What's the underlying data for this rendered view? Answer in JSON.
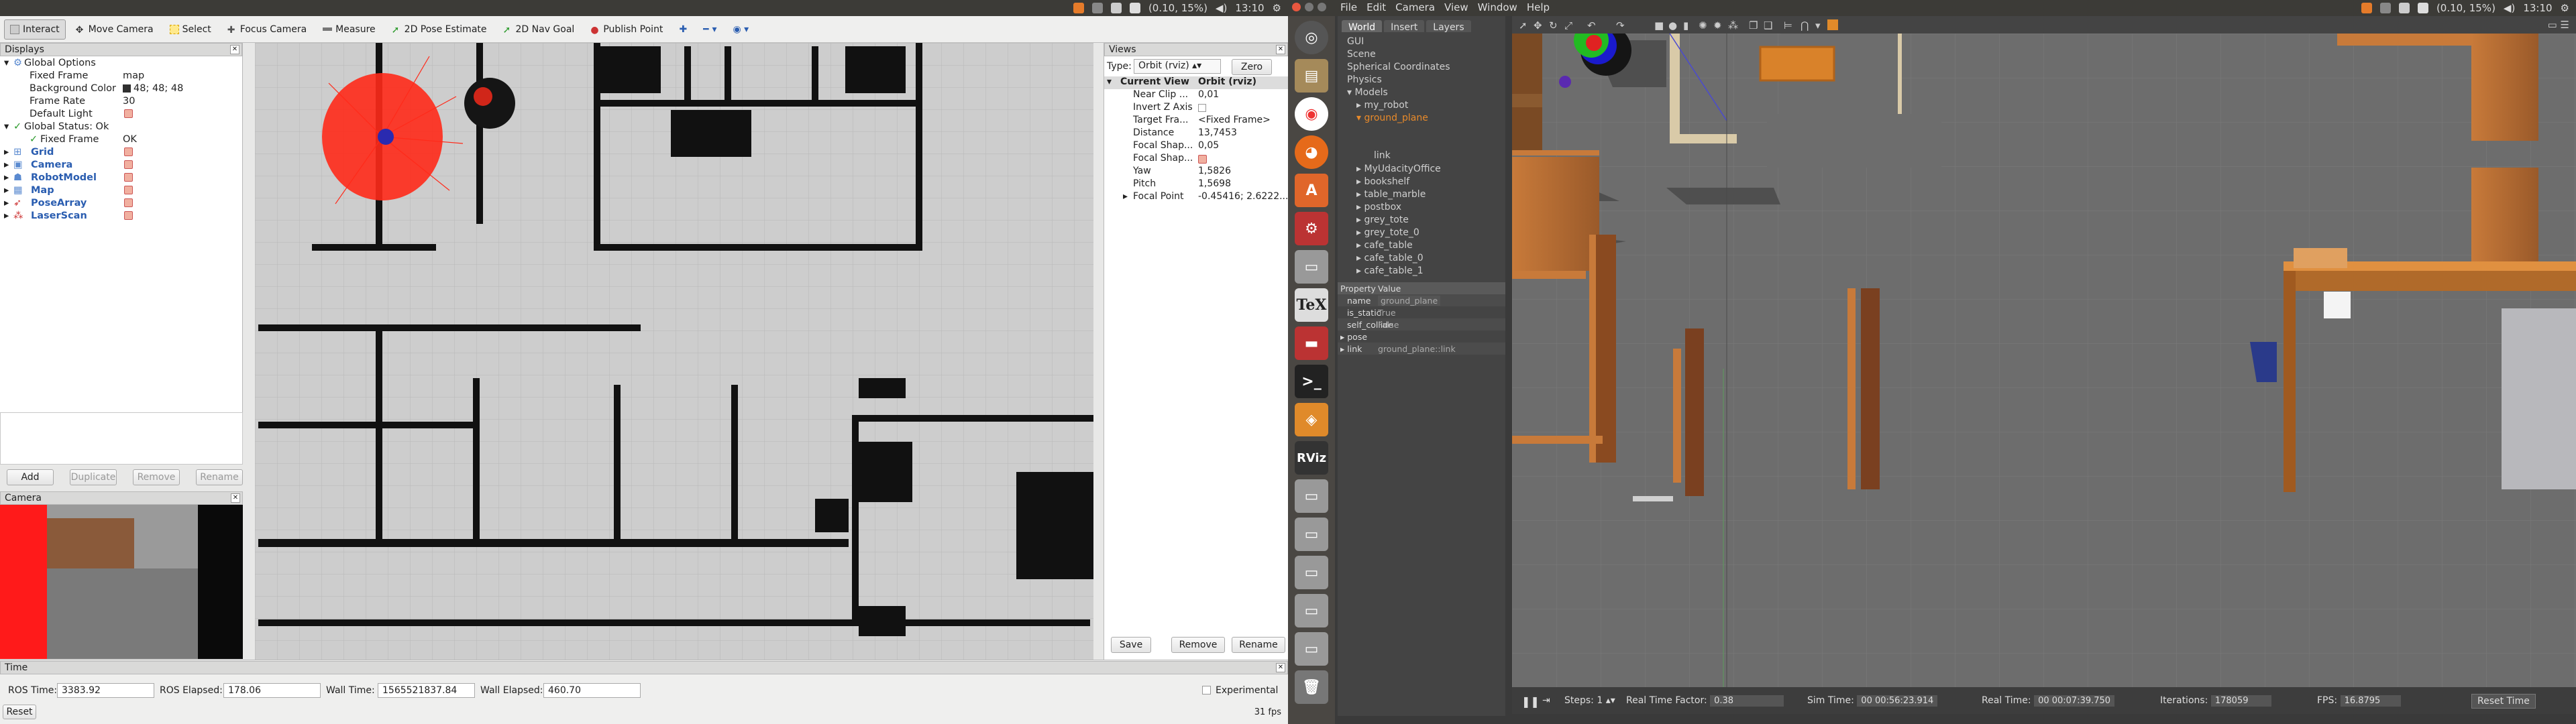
{
  "left_panel": {
    "time": "13:10",
    "coords": "(0.10, 15%)"
  },
  "rviz": {
    "tools": [
      {
        "label": "Interact",
        "icon": "interact-icon"
      },
      {
        "label": "Move Camera",
        "icon": "move-camera-icon"
      },
      {
        "label": "Select",
        "icon": "select-icon"
      },
      {
        "label": "Focus Camera",
        "icon": "focus-camera-icon"
      },
      {
        "label": "Measure",
        "icon": "measure-icon"
      },
      {
        "label": "2D Pose Estimate",
        "icon": "pose-estimate-icon"
      },
      {
        "label": "2D Nav Goal",
        "icon": "nav-goal-icon"
      },
      {
        "label": "Publish Point",
        "icon": "publish-point-icon"
      }
    ],
    "displays": {
      "title": "Displays",
      "global_options": "Global Options",
      "fixed_frame_k": "Fixed Frame",
      "fixed_frame_v": "map",
      "bg_k": "Background Color",
      "bg_v": "48; 48; 48",
      "rate_k": "Frame Rate",
      "rate_v": "30",
      "light_k": "Default Light",
      "status": "Global Status: Ok",
      "status_frame_k": "Fixed Frame",
      "status_frame_v": "OK",
      "items": [
        "Grid",
        "Camera",
        "RobotModel",
        "Map",
        "PoseArray",
        "LaserScan"
      ],
      "buttons": {
        "add": "Add",
        "duplicate": "Duplicate",
        "remove": "Remove",
        "rename": "Rename"
      }
    },
    "camera_title": "Camera",
    "views": {
      "title": "Views",
      "type_label": "Type:",
      "type_value": "Orbit (rviz)",
      "zero": "Zero",
      "current_view_k": "Current View",
      "current_view_v": "Orbit (rviz)",
      "rows": [
        {
          "k": "Near Clip ...",
          "v": "0,01"
        },
        {
          "k": "Invert Z Axis",
          "v": ""
        },
        {
          "k": "Target Fra...",
          "v": "<Fixed Frame>"
        },
        {
          "k": "Distance",
          "v": "13,7453"
        },
        {
          "k": "Focal Shap...",
          "v": "0,05"
        },
        {
          "k": "Focal Shap...",
          "v": ""
        },
        {
          "k": "Yaw",
          "v": "1,5826"
        },
        {
          "k": "Pitch",
          "v": "1,5698"
        },
        {
          "k": "Focal Point",
          "v": "-0.45416; 2.6222..."
        }
      ],
      "buttons": {
        "save": "Save",
        "remove": "Remove",
        "rename": "Rename"
      }
    },
    "time_panel": {
      "title": "Time",
      "ros_time_label": "ROS Time:",
      "ros_time": "3383.92",
      "ros_elapsed_label": "ROS Elapsed:",
      "ros_elapsed": "178.06",
      "wall_time_label": "Wall Time:",
      "wall_time": "1565521837.84",
      "wall_elapsed_label": "Wall Elapsed:",
      "wall_elapsed": "460.70",
      "experimental": "Experimental",
      "reset": "Reset",
      "fps": "31 fps"
    }
  },
  "gazebo": {
    "menu": [
      "File",
      "Edit",
      "Camera",
      "View",
      "Window",
      "Help"
    ],
    "time": "13:10",
    "coords": "(0.10, 15%)",
    "tabs": [
      "World",
      "Insert",
      "Layers"
    ],
    "world_tree": [
      "GUI",
      "Scene",
      "Spherical Coordinates",
      "Physics",
      "Models",
      "my_robot",
      "ground_plane",
      "link",
      "MyUdacityOffice",
      "bookshelf",
      "table_marble",
      "postbox",
      "grey_tote",
      "grey_tote_0",
      "cafe_table",
      "cafe_table_0",
      "cafe_table_1"
    ],
    "props": {
      "header_k": "Property",
      "header_v": "Value",
      "rows": [
        {
          "k": "name",
          "v": "ground_plane"
        },
        {
          "k": "is_static",
          "v": "True"
        },
        {
          "k": "self_collide",
          "v": "False"
        },
        {
          "k": "pose",
          "v": ""
        },
        {
          "k": "link",
          "v": "ground_plane::link"
        }
      ]
    },
    "bottom": {
      "steps_label": "Steps:",
      "steps": "1",
      "rtf_label": "Real Time Factor:",
      "rtf": "0.38",
      "sim_label": "Sim Time:",
      "sim": "00 00:56:23.914",
      "real_label": "Real Time:",
      "real": "00 00:07:39.750",
      "iter_label": "Iterations:",
      "iter": "178059",
      "fps_label": "FPS:",
      "fps": "16.8795",
      "reset": "Reset Time"
    }
  }
}
